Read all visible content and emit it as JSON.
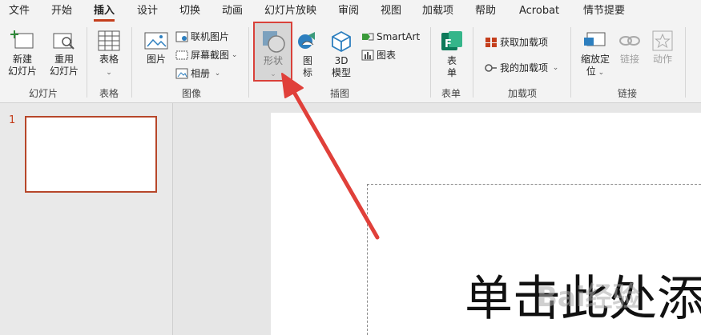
{
  "menu": {
    "tabs": [
      "文件",
      "开始",
      "插入",
      "设计",
      "切换",
      "动画",
      "幻灯片放映",
      "审阅",
      "视图",
      "加载项",
      "帮助",
      "Acrobat",
      "情节提要"
    ],
    "active_tab": "插入"
  },
  "ribbon": {
    "slides": {
      "new_slide": "新建\n幻灯片",
      "reuse_slide": "重用\n幻灯片",
      "group": "幻灯片"
    },
    "tables": {
      "table": "表格",
      "group": "表格"
    },
    "images": {
      "picture": "图片",
      "online_pictures": "联机图片",
      "screenshot": "屏幕截图",
      "album": "相册",
      "group": "图像"
    },
    "illustrations": {
      "shapes": "形状",
      "icons": "图\n标",
      "model3d": "3D\n模型",
      "smartart": "SmartArt",
      "chart": "图表",
      "group": "插图"
    },
    "forms": {
      "form": "表\n单",
      "group": "表单"
    },
    "addins": {
      "get_addins": "获取加载项",
      "my_addins": "我的加载项",
      "group": "加载项"
    },
    "links": {
      "zoom": "缩放定\n位",
      "link": "链接",
      "action": "动作",
      "group": "链接"
    }
  },
  "thumbnails": {
    "slide_number": "1"
  },
  "slide": {
    "title_placeholder": "单击此处添"
  },
  "watermark": "Bai经验",
  "colors": {
    "accent": "#c43e1c",
    "highlight_border": "#d9413a",
    "arrow": "#e0403a"
  }
}
